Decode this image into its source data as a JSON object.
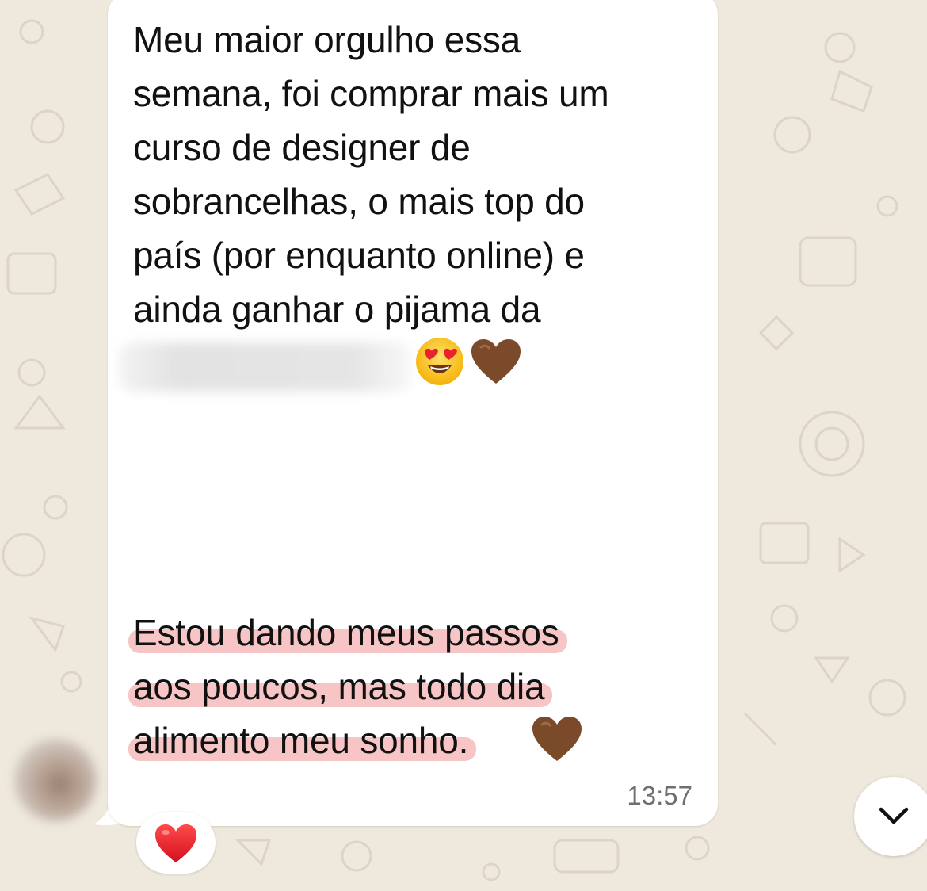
{
  "message": {
    "part1_lines": [
      "Meu maior orgulho essa",
      "semana, foi comprar mais um",
      "curso de designer de",
      "sobrancelhas, o mais top do",
      "país (por enquanto online) e",
      "ainda ganhar o pijama da"
    ],
    "part2_lines": [
      "Estou dando meus passos",
      "aos poucos, mas todo dia",
      "alimento meu sonho."
    ],
    "emojis": [
      "heart-eyes-emoji",
      "brown-heart-emoji",
      "brown-heart-emoji"
    ],
    "time": "13:57",
    "highlight_color": "#f29698"
  },
  "reaction": {
    "emoji": "red-heart-emoji",
    "color": "#e0182a"
  },
  "scroll_down": {
    "icon": "chevron-down-icon"
  },
  "colors": {
    "wallpaper": "#efe8dc",
    "bubble": "#ffffff",
    "brown_heart": "#7b4a2a"
  }
}
